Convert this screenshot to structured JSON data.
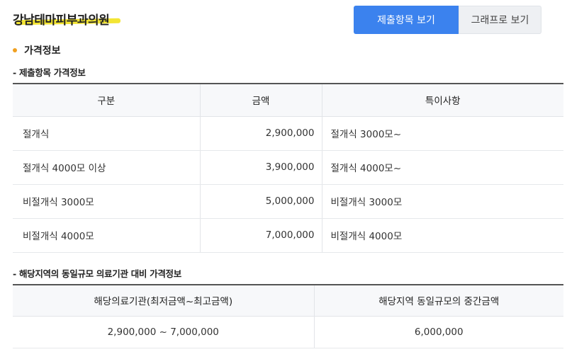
{
  "header": {
    "clinic_name": "강남테마피부과의원",
    "tabs": [
      {
        "label": "제출항목 보기",
        "active": true
      },
      {
        "label": "그래프로 보기",
        "active": false
      }
    ]
  },
  "section": {
    "title": "가격정보"
  },
  "price_table": {
    "subtitle": "- 제출항목 가격정보",
    "headers": [
      "구분",
      "금액",
      "특이사항"
    ],
    "rows": [
      [
        "절개식",
        "2,900,000",
        "절개식 3000모~"
      ],
      [
        "절개식 4000모 이상",
        "3,900,000",
        "절개식 4000모~"
      ],
      [
        "비절개식 3000모",
        "5,000,000",
        "비절개식 3000모"
      ],
      [
        "비절개식 4000모",
        "7,000,000",
        "비절개식 4000모"
      ]
    ]
  },
  "compare_table": {
    "subtitle": "- 해당지역의 동일규모 의료기관 대비 가격정보",
    "headers": [
      "해당의료기관(최저금액~최고금액)",
      "해당지역 동일규모의 중간금액"
    ],
    "row": [
      "2,900,000 ~ 7,000,000",
      "6,000,000"
    ]
  },
  "colors": {
    "accent": "#3b82ee",
    "highlight": "#f3e534",
    "bullet": "#f0a020"
  }
}
